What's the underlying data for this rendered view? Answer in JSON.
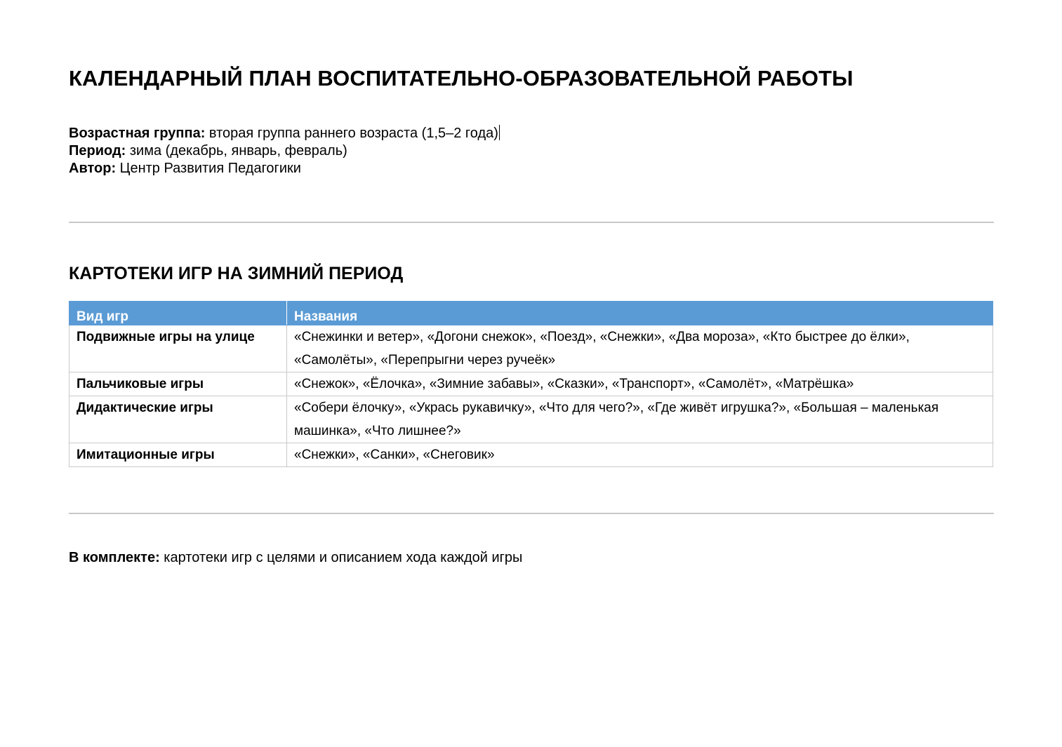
{
  "document": {
    "title": "КАЛЕНДАРНЫЙ ПЛАН ВОСПИТАТЕЛЬНО-ОБРАЗОВАТЕЛЬНОЙ РАБОТЫ",
    "meta": {
      "age_group": {
        "label": "Возрастная группа:",
        "value": " вторая группа раннего возраста (1,5–2 года)"
      },
      "period": {
        "label": "Период:",
        "value": " зима (декабрь, январь, февраль)"
      },
      "author": {
        "label": "Автор:",
        "value": " Центр Развития Педагогики"
      }
    },
    "section_title": "КАРТОТЕКИ ИГР НА ЗИМНИЙ ПЕРИОД",
    "table": {
      "headers": [
        "Вид игр",
        "Названия"
      ],
      "rows": [
        {
          "kind": "Подвижные игры на улице",
          "names": "«Снежинки и ветер», «Догони снежок», «Поезд», «Снежки», «Два мороза», «Кто быстрее до ёлки», «Самолёты», «Перепрыгни через ручеёк»"
        },
        {
          "kind": "Пальчиковые игры",
          "names": "«Снежок», «Ёлочка», «Зимние забавы», «Сказки», «Транспорт», «Самолёт», «Матрёшка»"
        },
        {
          "kind": "Дидактические игры",
          "names": "«Собери ёлочку», «Укрась рукавичку», «Что для чего?», «Где живёт игрушка?», «Большая – маленькая машинка», «Что лишнее?»"
        },
        {
          "kind": "Имитационные игры",
          "names": "«Снежки», «Санки», «Снеговик»"
        }
      ]
    },
    "footer": {
      "label": "В комплекте:",
      "value": " картотеки игр с целями и описанием хода каждой игры"
    },
    "colors": {
      "header_bg": "#5b9bd5",
      "header_text": "#ffffff",
      "rule": "#c8c8c8",
      "grid": "#c9c9c9"
    }
  }
}
